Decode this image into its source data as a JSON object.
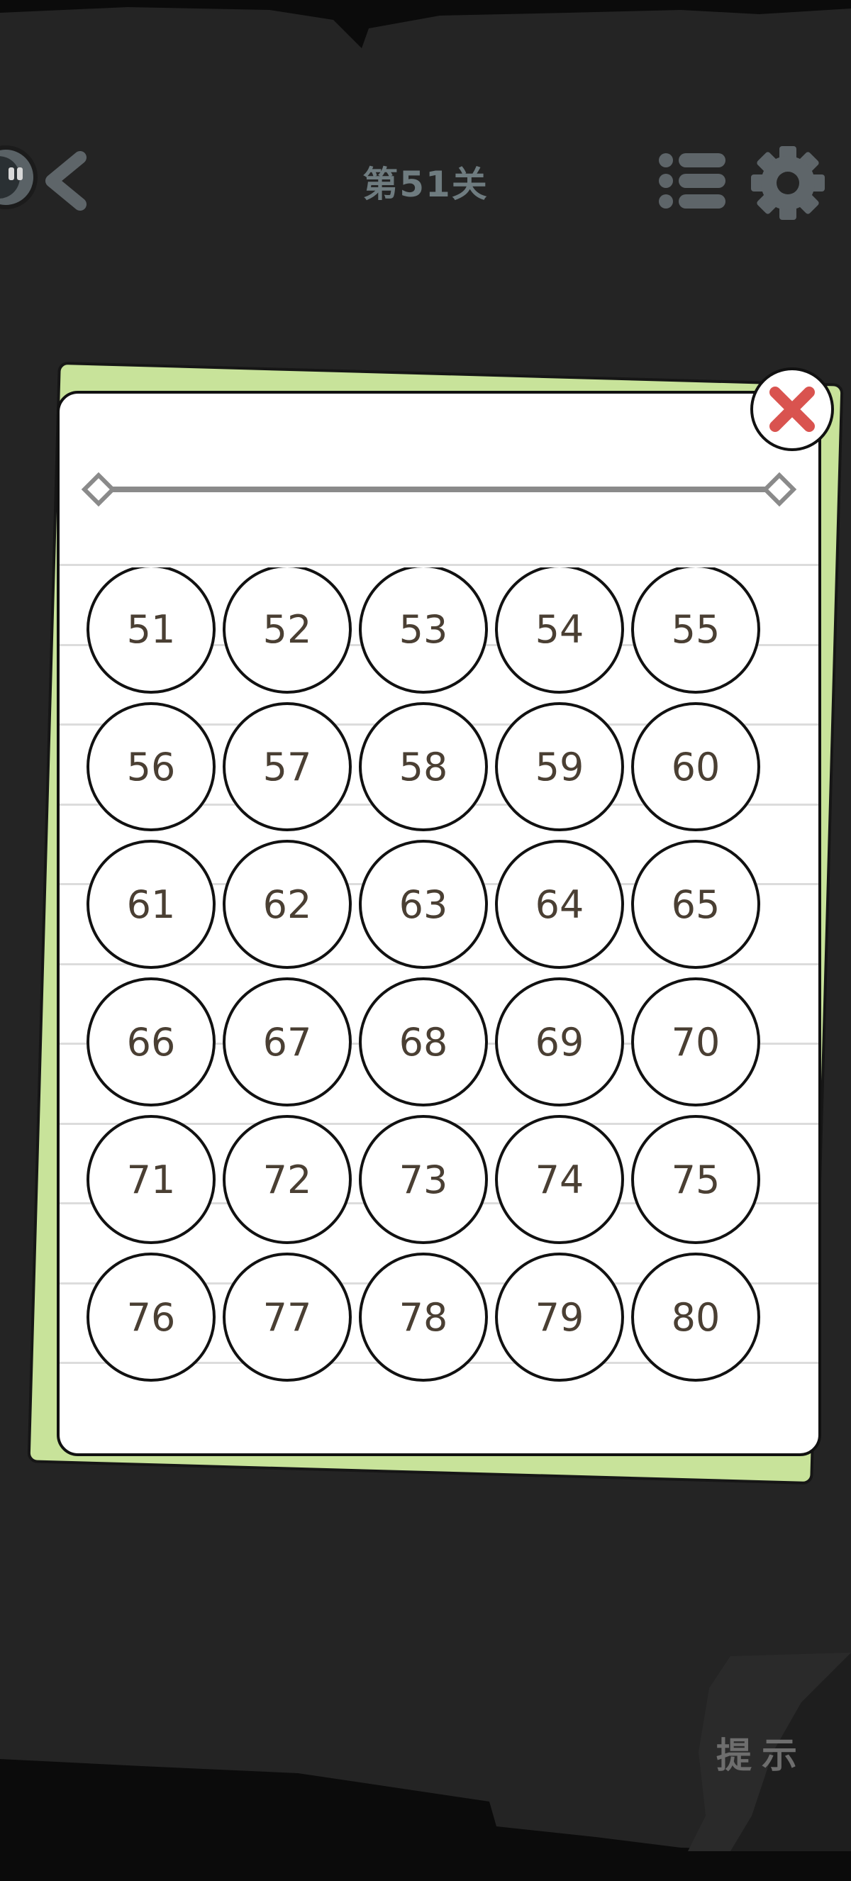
{
  "header": {
    "title": "第51关",
    "back_icon": "chevron-left-icon",
    "avatar_icon": "robot-face-icon",
    "menu_icon": "list-icon",
    "settings_icon": "gear-icon"
  },
  "dialog": {
    "close_icon": "close-icon",
    "levels": [
      "51",
      "52",
      "53",
      "54",
      "55",
      "56",
      "57",
      "58",
      "59",
      "60",
      "61",
      "62",
      "63",
      "64",
      "65",
      "66",
      "67",
      "68",
      "69",
      "70",
      "71",
      "72",
      "73",
      "74",
      "75",
      "76",
      "77",
      "78",
      "79",
      "80"
    ]
  },
  "hint": {
    "label": "提示"
  },
  "colors": {
    "background": "#242424",
    "accent_green": "#c8e39a",
    "close_red": "#d9534f",
    "number_text": "#4a3f33",
    "title_text": "#6f7c80"
  }
}
